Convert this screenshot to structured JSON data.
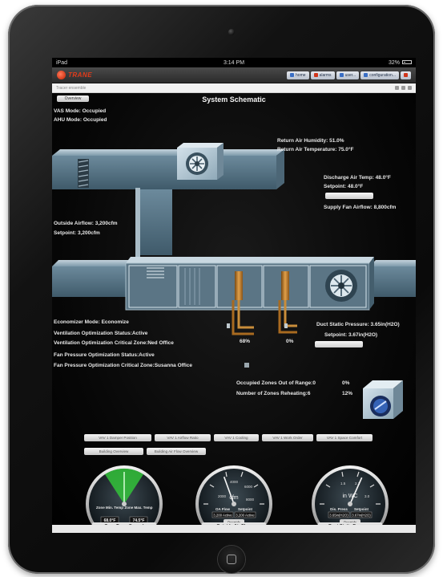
{
  "status_bar": {
    "carrier": "iPad",
    "time": "3:14 PM",
    "battery": "32%"
  },
  "header": {
    "brand": "TRANE",
    "tabs": [
      {
        "label": "home",
        "icon": "home-icon"
      },
      {
        "label": "alarms",
        "icon": "alarm-icon"
      },
      {
        "label": "user...",
        "icon": "user-icon"
      },
      {
        "label": "configuration...",
        "icon": "config-icon"
      },
      {
        "label": "",
        "icon": "help-icon"
      }
    ]
  },
  "breadcrumb": "Tracer ensemble",
  "schematic": {
    "title": "System Schematic",
    "back_button": "Overview",
    "vas_mode": "VAS Mode: Occupied",
    "ahu_mode": "AHU Mode: Occupied",
    "return_air_humidity": "Return Air Humidity: 51.0%",
    "return_air_temperature": "Return Air Temperature: 75.0°F",
    "discharge_air_temp": "Discharge Air Temp: 48.0°F",
    "discharge_setpoint": "Setpoint: 48.0°F",
    "supply_fan_airflow": "Supply Fan Airflow: 8,800cfm",
    "outside_airflow": "Outside Airflow: 3,200cfm",
    "outside_setpoint": "Setpoint: 3,200cfm",
    "economizer_mode": "Economizer Mode: Economize",
    "ventilation_status": "Ventilation Optimization Status:Active",
    "ventilation_critical_zone": "Ventilation Optimization Critical Zone:Ned Office",
    "fan_pressure_status": "Fan Pressure Optimization Status:Active",
    "fan_pressure_critical_zone": "Fan Pressure Optimization Critical Zone:Susanna Office",
    "cooling_valve": "68%",
    "heating_valve": "0%",
    "duct_static_pressure": "Duct Static Pressure: 3.65in(H2O)",
    "duct_setpoint": "Setpoint: 3.67in(H2O)",
    "occupied_zones_out_of_range": "Occupied Zones Out of Range:0",
    "occupied_zones_pct": "0%",
    "zones_reheating": "Number of Zones Reheating:6",
    "zones_reheating_pct": "12%"
  },
  "nav_buttons": [
    "VAV 1 Damper Position",
    "VAV 1 Airflow Ratio",
    "VAV 1 Cooling",
    "VAV 1 Work Order",
    "VAV 1 Space Comfort",
    "Building Overview",
    "Building Air Flow Overview"
  ],
  "gauges": [
    {
      "name": "zone-temp-spread",
      "button": "Zone Temp Spread",
      "left_label": "Zone Min. Temp",
      "right_label": "Zone Max. Temp",
      "left_value": "68.0°F",
      "right_value": "74.5°F"
    },
    {
      "name": "outside-air-flow",
      "button": "Outside Air Flow",
      "unit": "cfm",
      "scale": [
        "2000",
        "4000",
        "6000",
        "8000"
      ],
      "left_label": "OA Flow",
      "right_label": "Setpoint",
      "left_value": "3,200 Active",
      "right_value": "3,200 Active",
      "override": "Override",
      "level": 0.4
    },
    {
      "name": "duct-static-pressure",
      "button": "Duct Static Pressure",
      "unit": "in WC",
      "scale": [
        "1.5",
        "2.1",
        "3.0"
      ],
      "left_label": "Dis. Press",
      "right_label": "Setpoint",
      "left_value": "3.65in(H2O)",
      "right_value": "3.67in(H2O)",
      "override": "Override",
      "level": 0.62
    }
  ],
  "colors": {
    "accent_red": "#d0351b",
    "gauge_green": "#3cc23c",
    "duct_blue": "#5f8aa3"
  }
}
